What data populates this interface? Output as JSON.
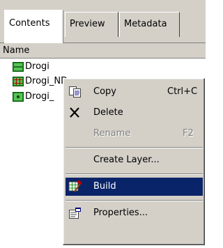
{
  "tabs": [
    {
      "label": "Contents",
      "active": true
    },
    {
      "label": "Preview",
      "active": false
    },
    {
      "label": "Metadata",
      "active": false
    }
  ],
  "list": {
    "column_header": "Name",
    "items": [
      {
        "label": "Drogi",
        "icon": "line-featureclass-icon"
      },
      {
        "label": "Drogi_ND",
        "icon": "network-dataset-icon"
      },
      {
        "label": "Drogi_",
        "icon": "junctions-featureclass-icon"
      }
    ]
  },
  "context_menu": {
    "items": [
      {
        "label": "Copy",
        "shortcut": "Ctrl+C",
        "icon": "copy-icon",
        "enabled": true
      },
      {
        "label": "Delete",
        "icon": "delete-x-icon",
        "enabled": true
      },
      {
        "label": "Rename",
        "shortcut": "F2",
        "enabled": false
      },
      {
        "label": "Create Layer...",
        "enabled": true
      },
      {
        "label": "Build",
        "icon": "build-icon",
        "enabled": true,
        "highlighted": true
      },
      {
        "label": "Properties...",
        "icon": "properties-icon",
        "enabled": true
      }
    ]
  },
  "colors": {
    "face": "#d4d0c8",
    "highlight": "#0a246a"
  }
}
